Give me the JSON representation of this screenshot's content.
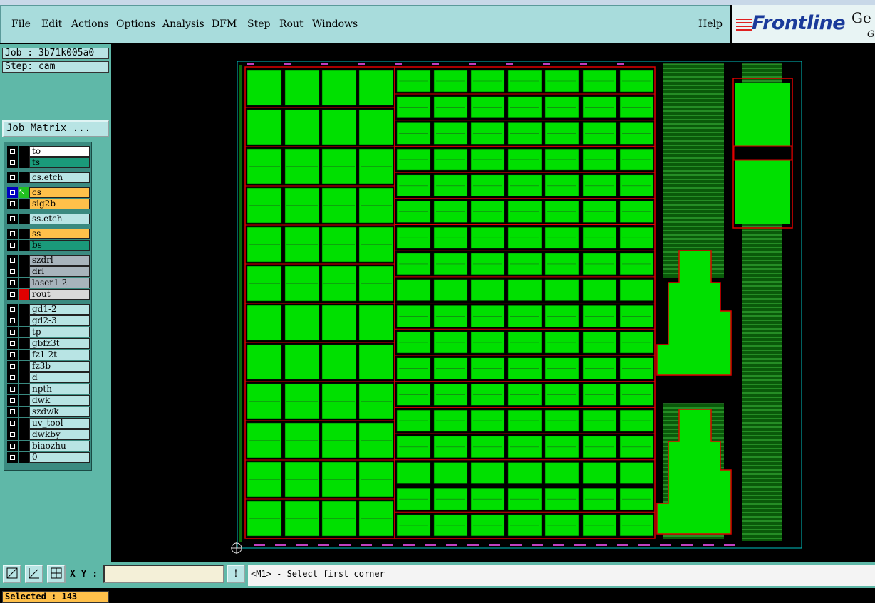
{
  "menu": {
    "items": [
      "File",
      "Edit",
      "Actions",
      "Options",
      "Analysis",
      "DFM",
      "Step",
      "Rout",
      "Windows"
    ],
    "help": "Help"
  },
  "logo": {
    "word": "Frontline",
    "ge": "Ge",
    "g2": "G"
  },
  "panel": {
    "job": "Job : 3b71k005a0",
    "step": "Step: cam",
    "job_matrix": "Job Matrix ...",
    "selected": "Selected : 143"
  },
  "layers": [
    {
      "name": "to",
      "color": "#ffffff"
    },
    {
      "name": "ts",
      "color": "#1a9a7a"
    },
    {
      "name": "cs.etch",
      "color": "#b8e4e4"
    },
    {
      "name": "cs",
      "color": "#ffc04a",
      "active": true
    },
    {
      "name": "sig2b",
      "color": "#ffc04a"
    },
    {
      "name": "ss.etch",
      "color": "#b8e4e4"
    },
    {
      "name": "ss",
      "color": "#ffc04a"
    },
    {
      "name": "bs",
      "color": "#1a9a7a"
    },
    {
      "name": "szdrl",
      "color": "#a8b4bc"
    },
    {
      "name": "drl",
      "color": "#a8b4bc"
    },
    {
      "name": "laser1-2",
      "color": "#a8b4bc"
    },
    {
      "name": "rout",
      "color": "#d8d8d8",
      "rout": true
    },
    {
      "name": "gd1-2",
      "color": "#b8e4e4"
    },
    {
      "name": "gd2-3",
      "color": "#b8e4e4"
    },
    {
      "name": "tp",
      "color": "#b8e4e4"
    },
    {
      "name": "gbfz3t",
      "color": "#b8e4e4"
    },
    {
      "name": "fz1-2t",
      "color": "#b8e4e4"
    },
    {
      "name": "fz3b",
      "color": "#b8e4e4"
    },
    {
      "name": "d",
      "color": "#b8e4e4"
    },
    {
      "name": "npth",
      "color": "#b8e4e4"
    },
    {
      "name": "dwk",
      "color": "#b8e4e4"
    },
    {
      "name": "szdwk",
      "color": "#b8e4e4"
    },
    {
      "name": "uv_tool",
      "color": "#b8e4e4"
    },
    {
      "name": "dwkby",
      "color": "#b8e4e4"
    },
    {
      "name": "biaozhu",
      "color": "#b8e4e4"
    },
    {
      "name": "0",
      "color": "#b8e4e4"
    }
  ],
  "status": {
    "xy_label": "X Y :",
    "xy_value": "",
    "prompt": "<M1> - Select first corner",
    "alert_glyph": "!"
  },
  "colors": {
    "board_fill": "#00e000",
    "rout_line": "#e00000",
    "panel_bg": "#5fb8a8",
    "menubar_bg": "#a8dcdc"
  }
}
